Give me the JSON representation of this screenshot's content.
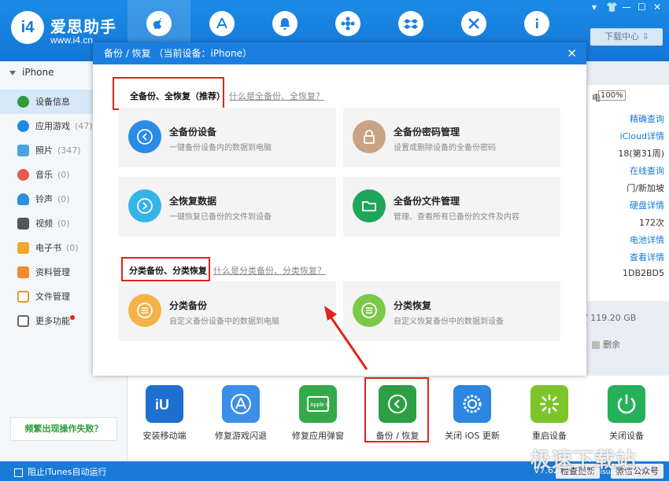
{
  "app": {
    "title": "爱思助手",
    "url": "www.i4.cn",
    "logo_text": "i4",
    "window_controls": [
      "▾",
      "—",
      "☐",
      "✕"
    ],
    "download_center": "下载中心"
  },
  "nav_icons": [
    "apple-icon",
    "appstore-icon",
    "bell-icon",
    "flower-icon",
    "dropbox-icon",
    "tools-icon",
    "info-icon"
  ],
  "sidebar": {
    "device": "iPhone",
    "items": [
      {
        "label": "设备信息",
        "count": ""
      },
      {
        "label": "应用游戏",
        "count": "(47)"
      },
      {
        "label": "照片",
        "count": "(347)"
      },
      {
        "label": "音乐",
        "count": "(0)"
      },
      {
        "label": "铃声",
        "count": "(0)"
      },
      {
        "label": "视频",
        "count": "(0)"
      },
      {
        "label": "电子书",
        "count": "(0)"
      },
      {
        "label": "资料管理",
        "count": ""
      },
      {
        "label": "文件管理",
        "count": ""
      },
      {
        "label": "更多功能",
        "count": ""
      }
    ],
    "fail_button": "频繁出现操作失败？"
  },
  "statusbar": {
    "itunes_label": "阻止iTunes自动运行",
    "version": "V7.62",
    "check_update": "检查更新",
    "wechat": "微信公众号"
  },
  "right_info": {
    "percent": "100%",
    "lines": [
      "精确查询",
      "iCloud详情",
      "18(第31周)",
      "在线查询",
      "门/新加坡",
      "硬盘详情",
      "172次",
      "电池详情",
      "查看详情",
      "1DB2BD5"
    ],
    "partial": "电",
    "storage": "Y 119.20 GB",
    "erase": "删余"
  },
  "tools": [
    {
      "label": "安装移动端"
    },
    {
      "label": "修复游戏闪退"
    },
    {
      "label": "修复应用弹窗"
    },
    {
      "label": "备份 / 恢复"
    },
    {
      "label": "关闭 iOS 更新"
    },
    {
      "label": "重启设备"
    },
    {
      "label": "关闭设备"
    }
  ],
  "dialog": {
    "title": "备份 / 恢复 （当前设备：iPhone）",
    "close": "✕",
    "section1": {
      "title": "全备份、全恢复（推荐）",
      "link": "什么是全备份、全恢复？",
      "cards": [
        {
          "title": "全备份设备",
          "desc": "一键备份设备内的数据到电脑"
        },
        {
          "title": "全备份密码管理",
          "desc": "设置或删除设备的全备份密码"
        },
        {
          "title": "全恢复数据",
          "desc": "一键恢复已备份的文件到设备"
        },
        {
          "title": "全备份文件管理",
          "desc": "管理、查看所有已备份的文件及内容"
        }
      ]
    },
    "section2": {
      "title": "分类备份、分类恢复",
      "link": "什么是分类备份、分类恢复？",
      "cards": [
        {
          "title": "分类备份",
          "desc": "自定义备份设备中的数据到电脑"
        },
        {
          "title": "分类恢复",
          "desc": "自定义恢复备份中的数据到设备"
        }
      ]
    }
  },
  "watermark": {
    "text": "极速下载站",
    "url": "www.jisuxz.com"
  },
  "colors": {
    "brand": "#1b7fe0",
    "highlight": "#e2231a",
    "green": "#2e9a3c"
  }
}
